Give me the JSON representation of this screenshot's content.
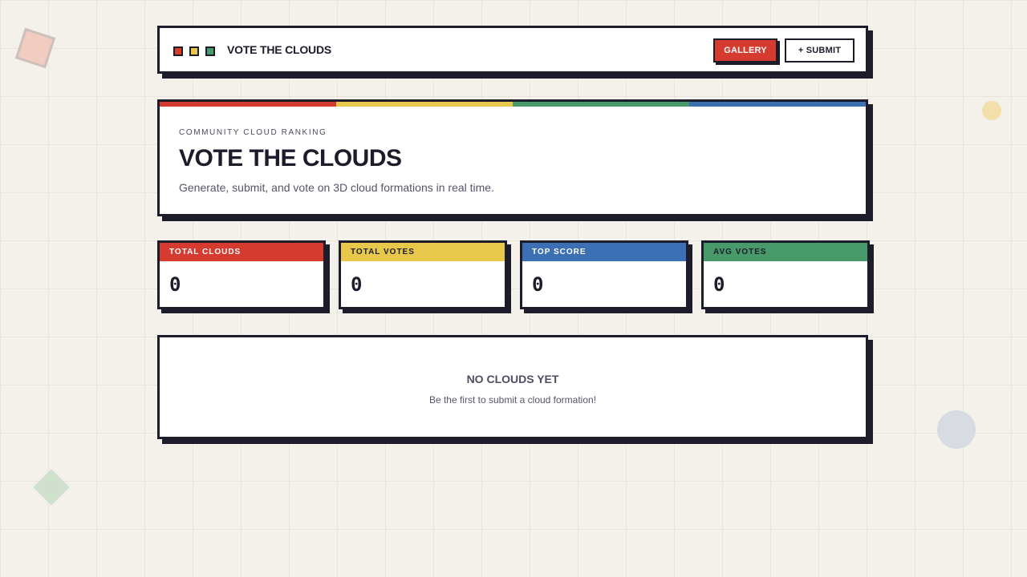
{
  "header": {
    "brand": "VOTE THE CLOUDS",
    "gallery_label": "GALLERY",
    "submit_label": "+ SUBMIT"
  },
  "hero": {
    "eyebrow": "COMMUNITY CLOUD RANKING",
    "title": "VOTE THE CLOUDS",
    "subtitle": "Generate, submit, and vote on 3D cloud formations in real time."
  },
  "stats": [
    {
      "label": "TOTAL CLOUDS",
      "value": "0",
      "color": "#d63b30",
      "text_color": "#ffffff"
    },
    {
      "label": "TOTAL VOTES",
      "value": "0",
      "color": "#e8c84a",
      "text_color": "#1c1c2b"
    },
    {
      "label": "TOP SCORE",
      "value": "0",
      "color": "#3d6fb4",
      "text_color": "#ffffff"
    },
    {
      "label": "AVG VOTES",
      "value": "0",
      "color": "#489a6a",
      "text_color": "#1c1c2b"
    }
  ],
  "empty_state": {
    "title": "NO CLOUDS YET",
    "subtitle": "Be the first to submit a cloud formation!"
  },
  "colors": {
    "red": "#d63b30",
    "yellow": "#e8c84a",
    "green": "#489a6a",
    "blue": "#3d6fb4",
    "ink": "#1c1c2b",
    "background": "#f4f0ea"
  }
}
